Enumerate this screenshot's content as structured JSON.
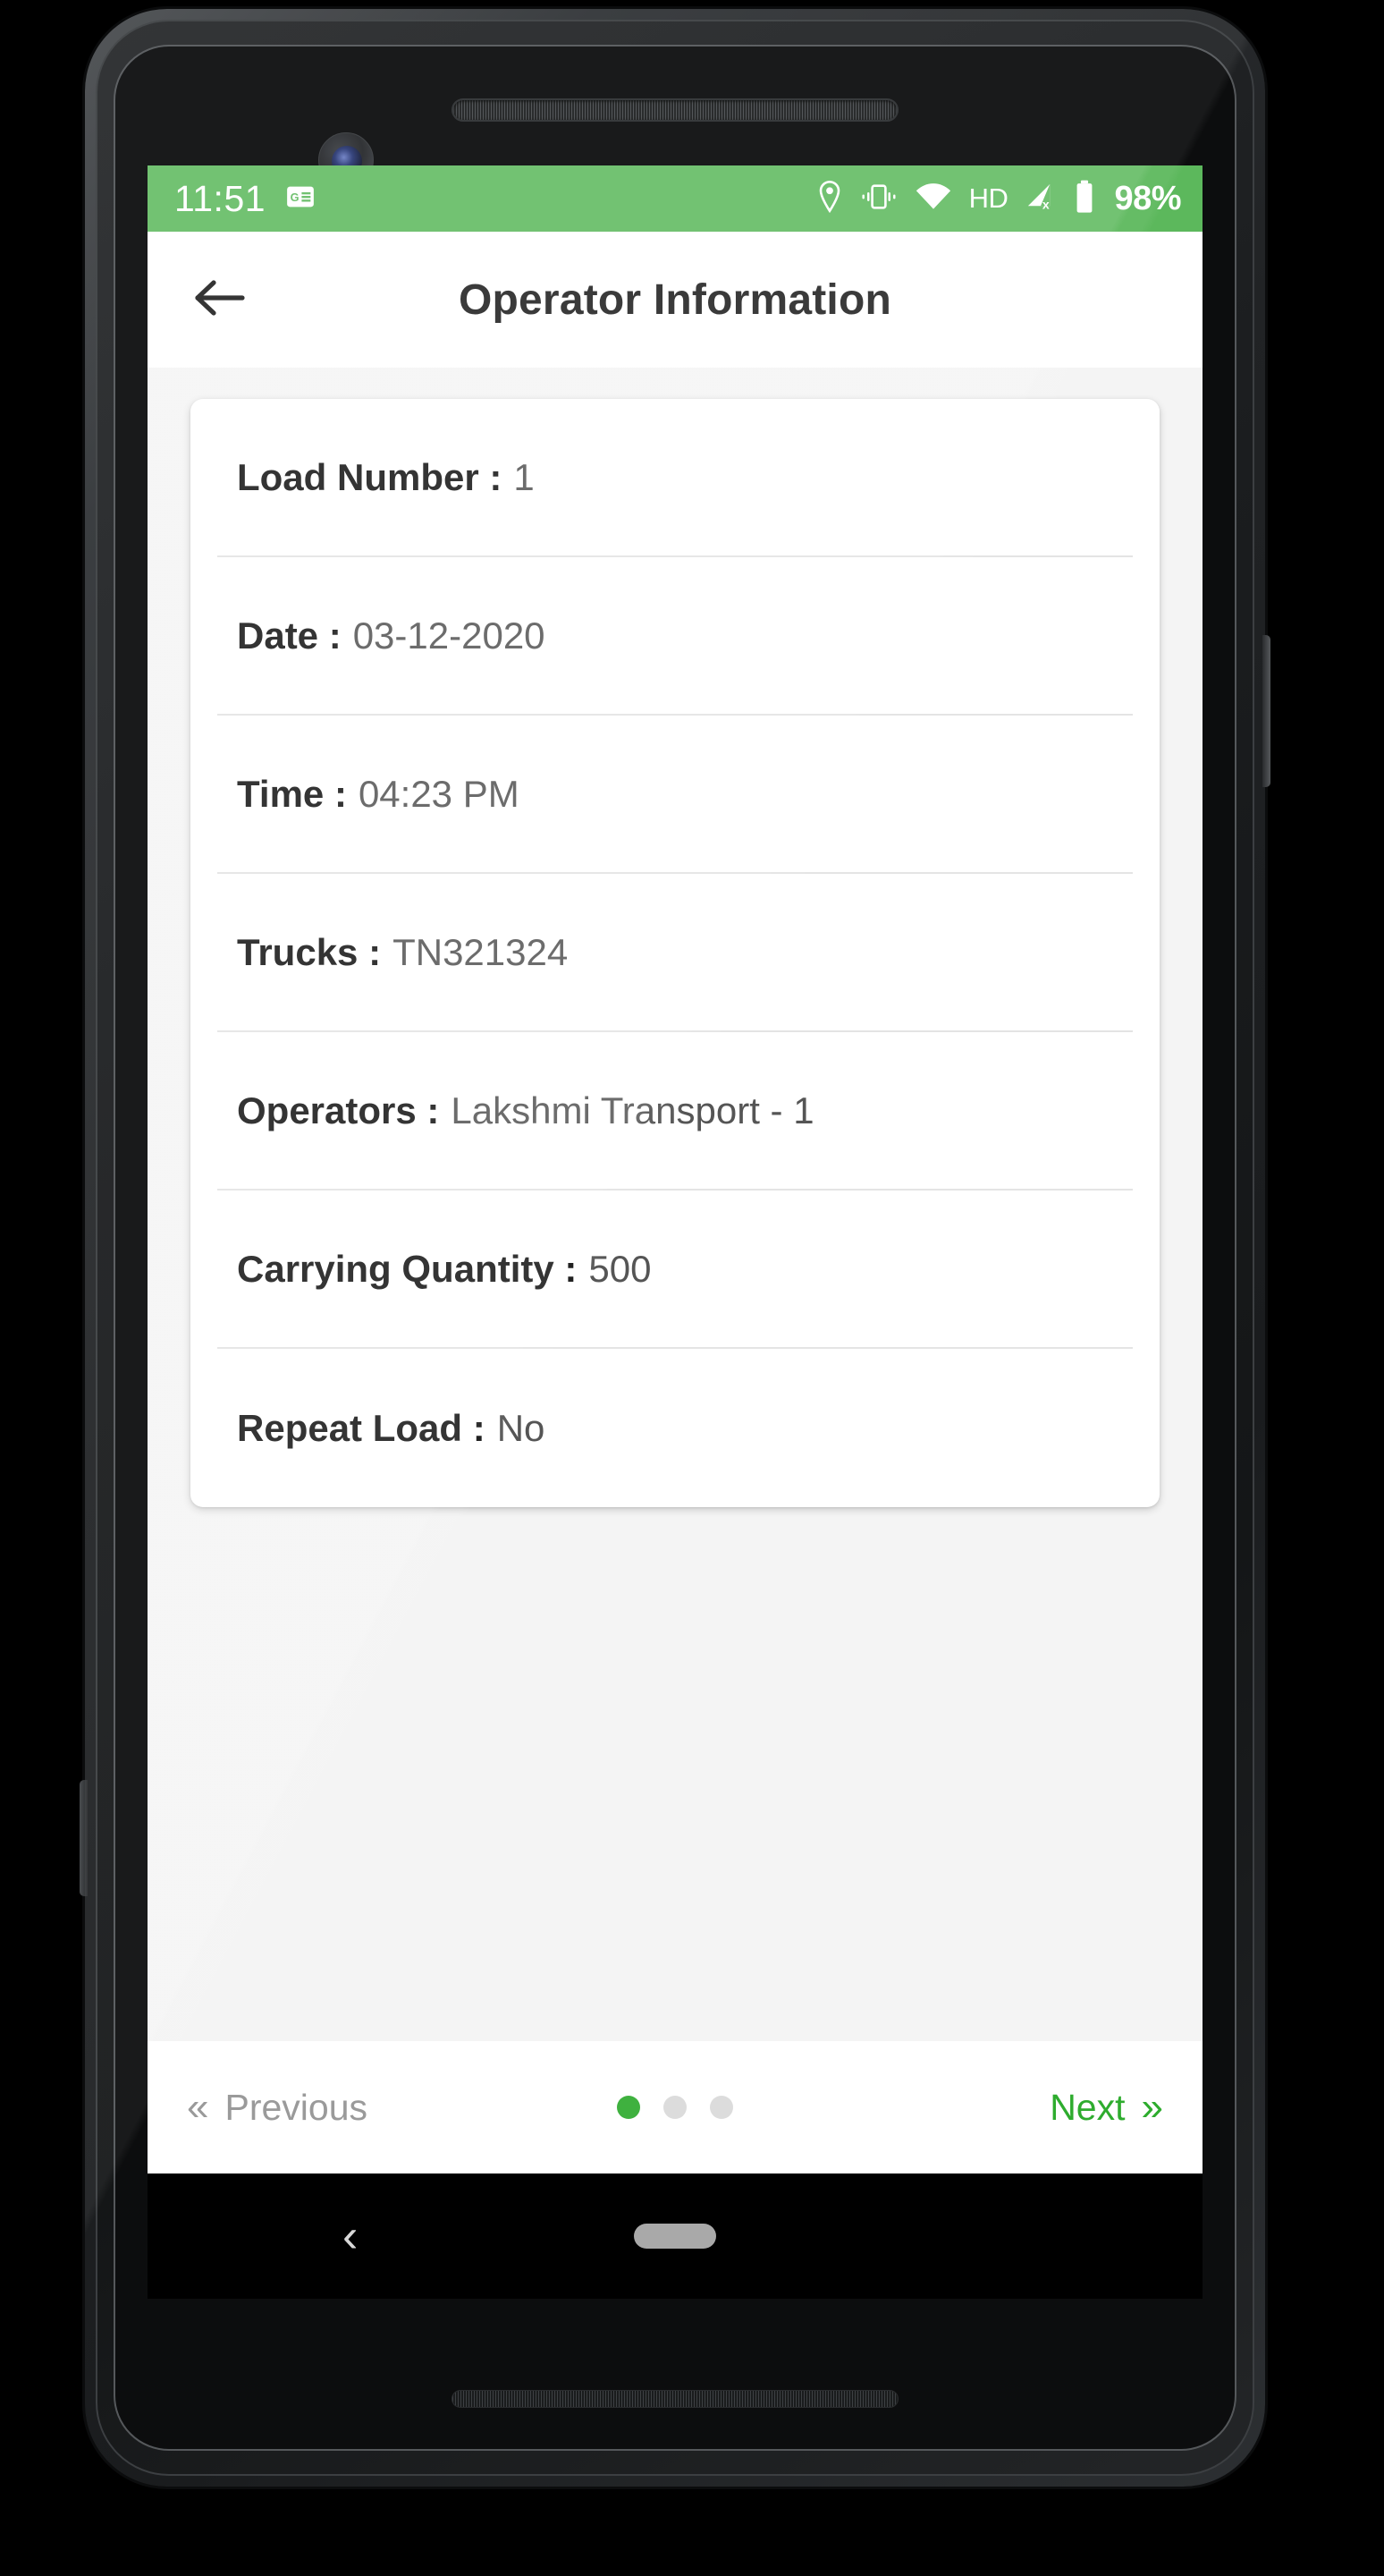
{
  "status_bar": {
    "clock": "11:51",
    "left_icons": [
      "google-news-icon"
    ],
    "right_icons": [
      "location-pin-icon",
      "vibrate-icon",
      "wifi-icon",
      "hd-icon",
      "signal-no-service-icon",
      "battery-icon"
    ],
    "hd_label": "HD",
    "battery_percent": "98%",
    "background_color": "#5cb85c",
    "text_color": "#ffffff"
  },
  "app_bar": {
    "back_icon": "arrow-left-icon",
    "title": "Operator Information",
    "background_color": "#ffffff"
  },
  "card": {
    "rows": [
      {
        "label": "Load Number :",
        "value": "1"
      },
      {
        "label": "Date :",
        "value": "03-12-2020"
      },
      {
        "label": "Time :",
        "value": "04:23 PM"
      },
      {
        "label": "Trucks :",
        "value": "TN321324"
      },
      {
        "label": "Operators :",
        "value": "Lakshmi Transport - 1"
      },
      {
        "label": "Carrying Quantity :",
        "value": "500"
      },
      {
        "label": "Repeat Load :",
        "value": "No"
      }
    ]
  },
  "pager": {
    "previous_label": "Previous",
    "previous_icon": "chevron-double-left-icon",
    "previous_color": "#9a9a9a",
    "next_label": "Next",
    "next_icon": "chevron-double-right-icon",
    "next_color": "#2eac2e",
    "total_pages": 3,
    "current_page": 1,
    "active_dot_color": "#3fb13f",
    "inactive_dot_color": "#dcdcdc"
  },
  "android_nav": {
    "back_icon": "nav-back-chevron-icon",
    "home_indicator": "home-pill-icon"
  },
  "glyphs": {
    "chevron_double_left": "«",
    "chevron_double_right": "»",
    "nav_back_chevron": "‹"
  }
}
